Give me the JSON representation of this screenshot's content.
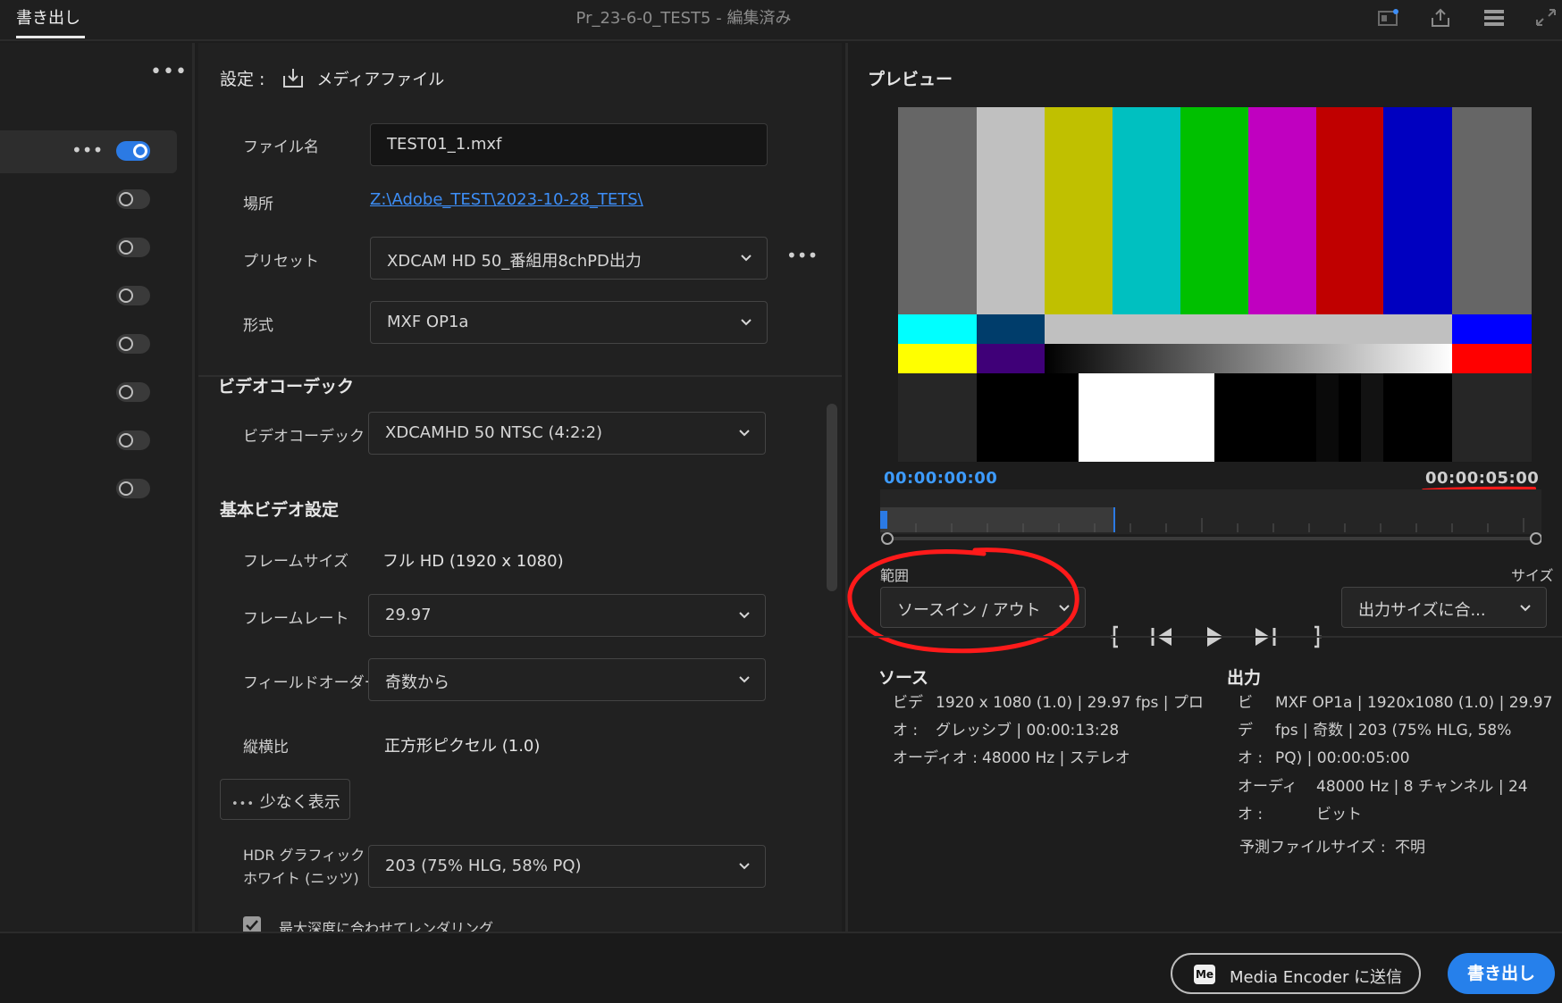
{
  "topbar": {
    "tab_export": "書き出し",
    "document_title": "Pr_23-6-0_TEST5 - 編集済み"
  },
  "settings": {
    "header_label": "設定 :",
    "header_target": "メディアファイル",
    "filename_label": "ファイル名",
    "filename_value": "TEST01_1.mxf",
    "location_label": "場所",
    "location_value": "Z:\\Adobe_TEST\\2023-10-28_TETS\\",
    "preset_label": "プリセット",
    "preset_value": "XDCAM HD 50_番組用8chPD出力",
    "format_label": "形式",
    "format_value": "MXF OP1a",
    "video_codec_section": "ビデオコーデック",
    "video_codec_label": "ビデオコーデック",
    "video_codec_value": "XDCAMHD 50 NTSC (4:2:2)",
    "basic_video_section": "基本ビデオ設定",
    "frame_size_label": "フレームサイズ",
    "frame_size_value": "フル HD (1920 x 1080)",
    "frame_rate_label": "フレームレート",
    "frame_rate_value": "29.97",
    "field_order_label": "フィールドオーダー",
    "field_order_value": "奇数から",
    "aspect_label": "縦横比",
    "aspect_value": "正方形ピクセル (1.0)",
    "show_less_label": "少なく表示",
    "hdr_label_line1": "HDR グラフィック",
    "hdr_label_line2": "ホワイト (ニッツ)",
    "hdr_value": "203 (75% HLG, 58% PQ)",
    "max_depth_label": "最大深度に合わせてレンダリング",
    "max_depth_checked": true
  },
  "sidebar": {
    "toggles": [
      true,
      false,
      false,
      false,
      false,
      false,
      false,
      false
    ]
  },
  "preview": {
    "title": "プレビュー",
    "timecode_in": "00:00:00:00",
    "timecode_out": "00:00:05:00",
    "range_label": "範囲",
    "range_value": "ソースイン / アウト",
    "size_label": "サイズ",
    "size_value": "出力サイズに合...",
    "source": {
      "heading": "ソース",
      "video_label_1": "ビデ",
      "video_label_2": "オ :",
      "video_line_1": "1920 x 1080 (1.0) | 29.97 fps | プロ",
      "video_line_2": "グレッシブ | 00:00:13:28",
      "audio_label": "オーディオ :",
      "audio_value": "48000 Hz | ステレオ"
    },
    "output": {
      "heading": "出力",
      "video_label_1": "ビ",
      "video_label_2": "デ",
      "video_label_3": "オ :",
      "video_line_1": "MXF OP1a | 1920x1080 (1.0) | 29.97",
      "video_line_2": "fps | 奇数 | 203 (75% HLG, 58%",
      "video_line_3": "PQ) | 00:00:05:00",
      "audio_label_1": "オーディ",
      "audio_label_2": "オ :",
      "audio_line_1": "48000 Hz | 8 チャンネル | 24",
      "audio_line_2": "ビット",
      "filesize_label": "予測ファイルサイズ :",
      "filesize_value": "不明"
    }
  },
  "bottombar": {
    "me_badge": "Me",
    "send_to_me": "Media Encoder に送信",
    "export": "書き出し"
  },
  "colors": {
    "accent": "#2680eb",
    "timecode_in": "#3d9bff",
    "annotation_red": "#ff1a1a"
  },
  "icons": [
    "import-icon",
    "more-icon",
    "chevron-down-icon",
    "play-icon",
    "step-back-icon",
    "step-forward-icon",
    "mark-in-icon",
    "mark-out-icon",
    "share-icon",
    "panel-icon",
    "menu-icon",
    "expand-icon"
  ]
}
